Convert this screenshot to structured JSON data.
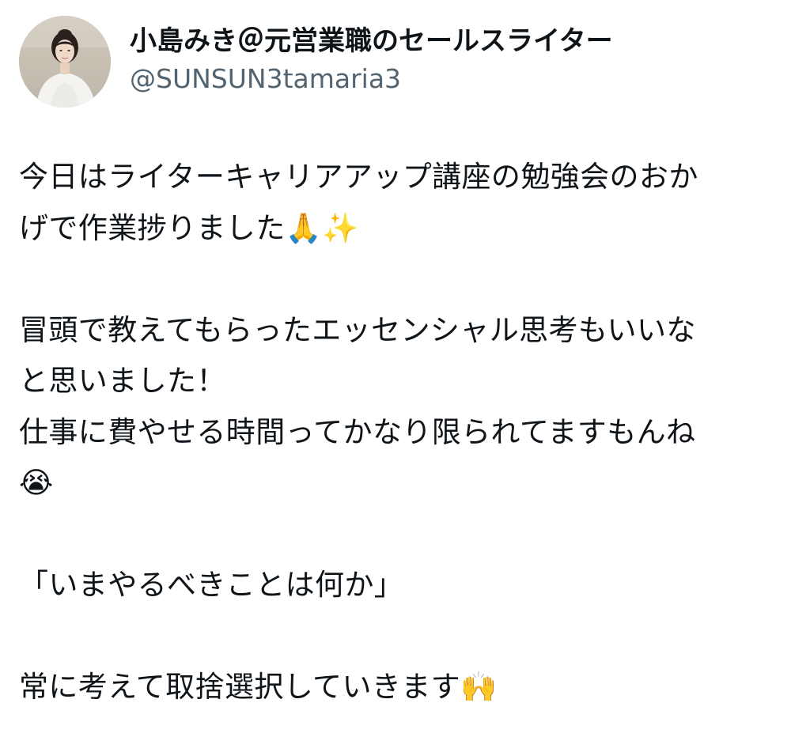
{
  "tweet": {
    "author": {
      "display_name": "小島みき＠元営業職のセールスライター",
      "handle": "@SUNSUN3tamaria3",
      "avatar": "profile-photo"
    },
    "body": {
      "p1_line1": "今日はライターキャリアアップ講座の勉強会のおか",
      "p1_line2": "げで作業捗りました🙏✨",
      "p2_line1": "冒頭で教えてもらったエッセンシャル思考もいいな",
      "p2_line2": "と思いました！",
      "p2_line3": "仕事に費やせる時間ってかなり限られてますもんね",
      "p2_line4": "😭",
      "p3_line1": "「いまやるべきことは何か」",
      "p4_line1": "常に考えて取捨選択していきます🙌"
    }
  }
}
